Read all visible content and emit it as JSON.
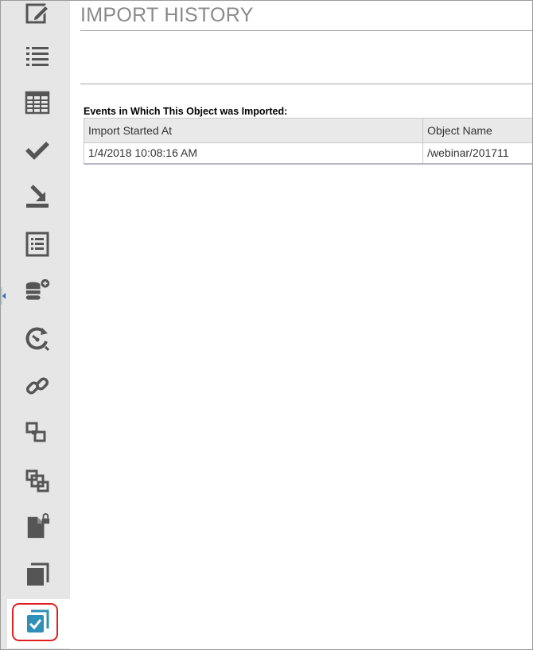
{
  "page": {
    "title": "IMPORT HISTORY",
    "section_label": "Events in Which This Object was Imported:"
  },
  "sidebar": {
    "items": [
      {
        "icon": "edit-icon"
      },
      {
        "icon": "list-icon"
      },
      {
        "icon": "table-icon"
      },
      {
        "icon": "checkmark-icon"
      },
      {
        "icon": "import-icon"
      },
      {
        "icon": "document-list-icon"
      },
      {
        "icon": "add-database-icon"
      },
      {
        "icon": "history-clock-icon"
      },
      {
        "icon": "link-icon"
      },
      {
        "icon": "dependencies-icon"
      },
      {
        "icon": "related-objects-icon"
      },
      {
        "icon": "locked-document-icon"
      },
      {
        "icon": "copies-icon"
      },
      {
        "icon": "import-history-icon",
        "active": true
      }
    ],
    "icon_color": "#555555",
    "active_icon_color": "#2f8fb6",
    "highlight_color": "#e0201f"
  },
  "events_table": {
    "columns": [
      "Import Started At",
      "Object Name"
    ],
    "rows": [
      [
        "1/4/2018 10:08:16 AM",
        "/webinar/201711"
      ]
    ]
  }
}
